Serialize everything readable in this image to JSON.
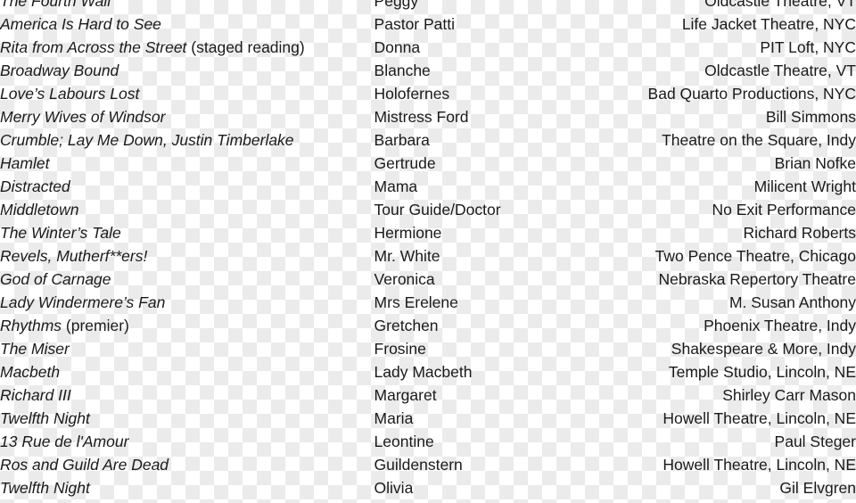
{
  "document": {
    "type": "theatre-credits-table",
    "column_count": 3,
    "row_count": 21,
    "text_color": "#1a1a1a",
    "background": "transparent"
  },
  "columns": [
    {
      "key": "production",
      "align": "left",
      "style": "italic",
      "name": "production-title"
    },
    {
      "key": "role",
      "align": "left",
      "style": "normal",
      "name": "role-name"
    },
    {
      "key": "venue",
      "align": "right",
      "style": "normal",
      "name": "venue-or-director"
    }
  ],
  "rows": [
    {
      "production": "The Fourth Wall",
      "production_note": "",
      "role": "Peggy",
      "venue": "Oldcastle Theatre, VT"
    },
    {
      "production": "America Is Hard to See",
      "production_note": "",
      "role": "Pastor Patti",
      "venue": "Life Jacket Theatre, NYC"
    },
    {
      "production": "Rita from Across the Street",
      "production_note": " (staged reading)",
      "role": "Donna",
      "venue": "PIT Loft, NYC"
    },
    {
      "production": "Broadway Bound",
      "production_note": "",
      "role": "Blanche",
      "venue": "Oldcastle Theatre, VT"
    },
    {
      "production": "Love’s Labours Lost",
      "production_note": "",
      "role": "Holofernes",
      "venue": "Bad Quarto Productions, NYC"
    },
    {
      "production": "Merry Wives of Windsor",
      "production_note": "",
      "role": "Mistress Ford",
      "venue": "Bill Simmons"
    },
    {
      "production": "Crumble; Lay Me Down, Justin Timberlake",
      "production_note": "",
      "role": "Barbara",
      "venue": "Theatre on the Square, Indy"
    },
    {
      "production": "Hamlet",
      "production_note": "",
      "role": "Gertrude",
      "venue": "Brian Nofke"
    },
    {
      "production": "Distracted",
      "production_note": "",
      "role": "Mama",
      "venue": "Milicent Wright"
    },
    {
      "production": "Middletown",
      "production_note": "",
      "role": "Tour Guide/Doctor",
      "venue": "No Exit Performance"
    },
    {
      "production": "The Winter’s Tale",
      "production_note": "",
      "role": "Hermione",
      "venue": "Richard Roberts"
    },
    {
      "production": "Revels, Mutherf**ers!",
      "production_note": "",
      "role": "Mr. White",
      "venue": "Two Pence Theatre, Chicago"
    },
    {
      "production": "God of Carnage",
      "production_note": "",
      "role": "Veronica",
      "venue": "Nebraska Repertory Theatre"
    },
    {
      "production": "Lady Windermere’s Fan",
      "production_note": "",
      "role": "Mrs Erelene",
      "venue": "M. Susan Anthony"
    },
    {
      "production": "Rhythms",
      "production_note": " (premier)",
      "role": "Gretchen",
      "venue": "Phoenix Theatre, Indy"
    },
    {
      "production": "The Miser",
      "production_note": "",
      "role": "Frosine",
      "venue": "Shakespeare & More, Indy"
    },
    {
      "production": "Macbeth",
      "production_note": "",
      "role": "Lady Macbeth",
      "venue": "Temple Studio, Lincoln, NE"
    },
    {
      "production": "Richard III",
      "production_note": "",
      "role": "Margaret",
      "venue": "Shirley Carr Mason"
    },
    {
      "production": "Twelfth Night",
      "production_note": "",
      "role": "Maria",
      "venue": "Howell Theatre, Lincoln, NE"
    },
    {
      "production": "13 Rue de l'Amour",
      "production_note": "",
      "role": "Leontine",
      "venue": "Paul Steger"
    },
    {
      "production": "Ros and Guild Are Dead",
      "production_note": "",
      "role": "Guildenstern",
      "venue": "Howell Theatre, Lincoln, NE"
    },
    {
      "production": "Twelfth Night",
      "production_note": "",
      "role": "Olivia",
      "venue": "Gil Elvgren"
    }
  ]
}
